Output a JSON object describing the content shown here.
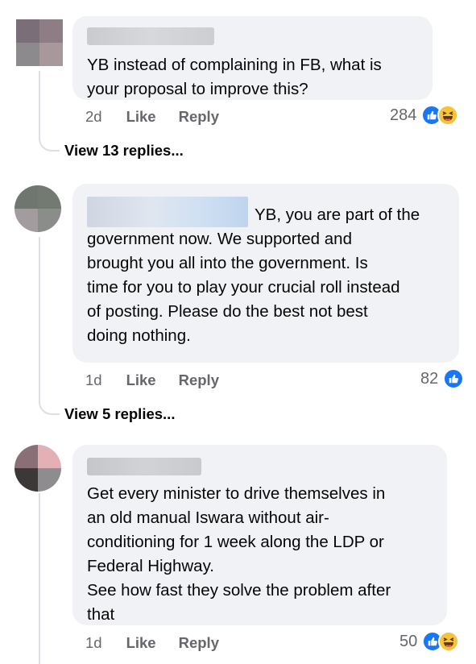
{
  "comments": [
    {
      "text": "YB instead of complaining in FB, what is\nyour proposal to improve this?",
      "time": "2d",
      "like_label": "Like",
      "reply_label": "Reply",
      "reaction_count": "284",
      "reactions": [
        "like-icon",
        "haha-icon"
      ],
      "view_replies": "View 13 replies..."
    },
    {
      "text": "YB, you are part of the\ngovernment now. We supported and\nbrought you all into the government. Is\ntime for you to play your crucial roll instead\nof posting. Please do the best not best\ndoing nothing.",
      "time": "1d",
      "like_label": "Like",
      "reply_label": "Reply",
      "reaction_count": "82",
      "reactions": [
        "like-icon"
      ],
      "view_replies": "View 5 replies..."
    },
    {
      "text": "Get every minister to drive themselves in\nan old manual Iswara without air-\nconditioning for 1 week along the LDP or\nFederal Highway.\nSee how fast they solve the problem after\nthat",
      "time": "1d",
      "like_label": "Like",
      "reply_label": "Reply",
      "reaction_count": "50",
      "reactions": [
        "like-icon",
        "haha-icon"
      ]
    }
  ],
  "colors": {
    "bubble": "#f0f2f5",
    "secondary_text": "#65676b",
    "like_blue": "#1877f2",
    "haha_yellow": "#f7c33b"
  }
}
